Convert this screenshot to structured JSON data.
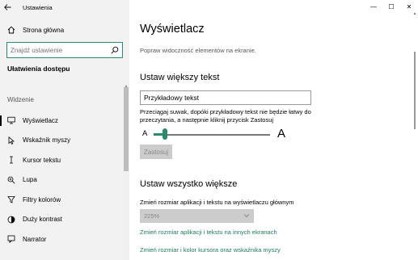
{
  "window": {
    "title": "Ustawienia",
    "controls": {
      "minimize": "—",
      "maximize": "☐",
      "close": "✕"
    }
  },
  "sidebar": {
    "back_icon": "back-arrow-icon",
    "home_label": "Strona główna",
    "search_placeholder": "Znajdź ustawienie",
    "section_title": "Ułatwienia dostępu",
    "group_label": "Widzenie",
    "items": [
      {
        "label": "Wyświetlacz",
        "icon": "display-icon",
        "active": true
      },
      {
        "label": "Wskaźnik myszy",
        "icon": "mouse-pointer-icon",
        "active": false
      },
      {
        "label": "Kursor tekstu",
        "icon": "text-cursor-icon",
        "active": false
      },
      {
        "label": "Lupa",
        "icon": "magnifier-icon",
        "active": false
      },
      {
        "label": "Filtry kolorów",
        "icon": "color-filter-icon",
        "active": false
      },
      {
        "label": "Duży kontrast",
        "icon": "high-contrast-icon",
        "active": false
      },
      {
        "label": "Narrator",
        "icon": "narrator-icon",
        "active": false
      }
    ]
  },
  "main": {
    "title": "Wyświetlacz",
    "subtitle": "Popraw widoczność elementów na ekranie.",
    "text_section": {
      "heading": "Ustaw większy tekst",
      "sample_text": "Przykładowy tekst",
      "description": "Przeciągaj suwak, dopóki przykładowy tekst nie będzie łatwy do przeczytania, a następnie kliknij przycisk Zastosuj",
      "slider_min_label": "A",
      "slider_max_label": "A",
      "slider_value": 0.1,
      "apply_label": "Zastosuj"
    },
    "scale_section": {
      "heading": "Ustaw wszystko większe",
      "label": "Zmień rozmiar aplikacji i tekstu na wyświetlaczu głównym",
      "select_value": "225%",
      "link_other_screens": "Zmień rozmiar aplikacji i tekstu na innych ekranach",
      "link_cursor": "Zmień rozmiar i kolor kursora oraz wskaźnika myszy"
    }
  },
  "colors": {
    "accent": "#2a8a6e",
    "link": "#1f7a5e",
    "sidebar_bg": "#f2f2f2"
  }
}
